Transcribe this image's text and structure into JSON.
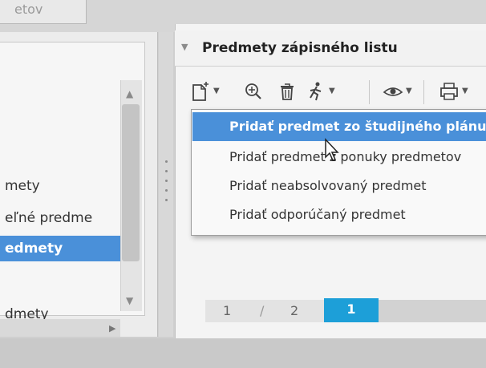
{
  "header": {
    "left_tab_label": "etov"
  },
  "left_panel": {
    "items": [
      {
        "label": "mety",
        "selected": false
      },
      {
        "label": "eľné predme",
        "selected": false
      },
      {
        "label": "edmety",
        "selected": true
      },
      {
        "label": "dmety",
        "selected": false
      }
    ]
  },
  "right_panel": {
    "title": "Predmety zápisného listu",
    "toolbar": {
      "icons": [
        "new-document-icon",
        "zoom-icon",
        "trash-icon",
        "runner-icon",
        "eye-icon",
        "print-icon"
      ]
    },
    "menu": {
      "items": [
        {
          "label": "Pridať predmet zo študijného plánu",
          "active": true
        },
        {
          "label": "Pridať predmet z ponuky predmetov",
          "active": false
        },
        {
          "label": "Pridať neabsolvovaný predmet",
          "active": false
        },
        {
          "label": "Pridať odporúčaný predmet",
          "active": false
        }
      ]
    },
    "pager": {
      "current": "1",
      "separator": "/",
      "total": "2",
      "active_page": "1"
    }
  },
  "colors": {
    "accent": "#4a90d9",
    "pager_active": "#1d9fd8"
  }
}
